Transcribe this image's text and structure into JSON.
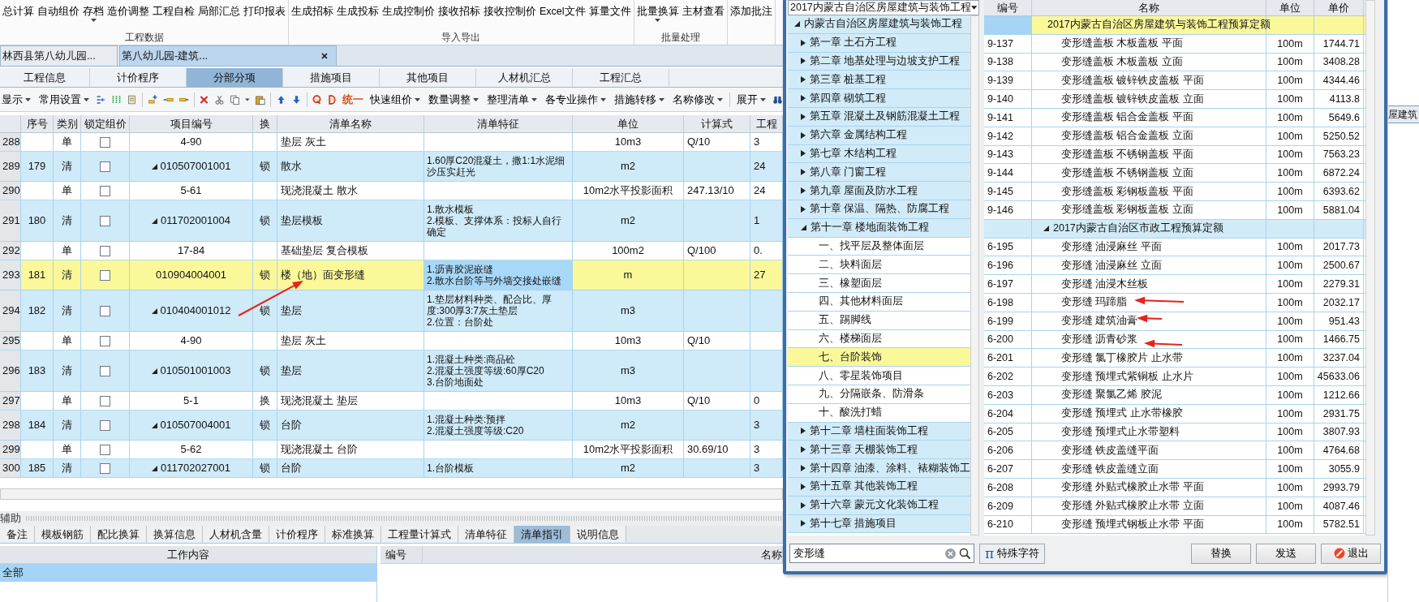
{
  "ribbon": {
    "groups": [
      {
        "label": "工程数据",
        "buttons": [
          {
            "label": "总计算",
            "dropdown": false
          },
          {
            "label": "自动组价",
            "dropdown": false
          },
          {
            "label": "存档",
            "dropdown": true
          },
          {
            "label": "造价调整",
            "dropdown": false
          },
          {
            "label": "工程自检",
            "dropdown": false
          },
          {
            "label": "局部汇总",
            "dropdown": false
          },
          {
            "label": "打印报表",
            "dropdown": false
          }
        ]
      },
      {
        "label": "导入导出",
        "buttons": [
          {
            "label": "生成招标",
            "dropdown": false
          },
          {
            "label": "生成投标",
            "dropdown": false
          },
          {
            "label": "生成控制价",
            "dropdown": false
          },
          {
            "label": "接收招标",
            "dropdown": false
          },
          {
            "label": "接收控制价",
            "dropdown": false
          },
          {
            "label": "Excel文件",
            "dropdown": false
          },
          {
            "label": "算量文件",
            "dropdown": false
          }
        ]
      },
      {
        "label": "批量处理",
        "buttons": [
          {
            "label": "批量换算",
            "dropdown": true
          },
          {
            "label": "主材查看",
            "dropdown": false
          }
        ]
      },
      {
        "buttons": [
          {
            "label": "添加批注",
            "dropdown": false
          }
        ]
      }
    ]
  },
  "document_tabs": [
    {
      "label": "林西县第八幼儿园...",
      "selected": false
    },
    {
      "label": "第八幼儿园-建筑...",
      "selected": true,
      "closable": true
    }
  ],
  "view_tabs": [
    {
      "label": "工程信息",
      "selected": false
    },
    {
      "label": "计价程序",
      "selected": false
    },
    {
      "label": "分部分项",
      "selected": true
    },
    {
      "label": "措施项目",
      "selected": false
    },
    {
      "label": "其他项目",
      "selected": false
    },
    {
      "label": "人材机汇总",
      "selected": false
    },
    {
      "label": "工程汇总",
      "selected": false
    }
  ],
  "toolbar": {
    "menus": [
      {
        "label": "显示",
        "dropdown": true
      },
      {
        "label": "常用设置",
        "dropdown": true
      }
    ],
    "unify_label": "统一",
    "actions": [
      {
        "label": "快速组价",
        "dropdown": true
      },
      {
        "label": "数量调整",
        "dropdown": true
      },
      {
        "label": "整理清单",
        "dropdown": true
      },
      {
        "label": "各专业操作",
        "dropdown": true
      },
      {
        "label": "措施转移",
        "dropdown": true
      },
      {
        "label": "名称修改",
        "dropdown": true
      },
      {
        "label": "展开",
        "dropdown": true
      }
    ]
  },
  "table": {
    "columns": [
      "",
      "序号",
      "类别",
      "锁定组价",
      "项目编号",
      "换",
      "清单名称",
      "清单特征",
      "单位",
      "计算式",
      "工程"
    ],
    "rows": [
      {
        "row": "288",
        "seq": "",
        "kind": "dan",
        "type": "单",
        "locked": false,
        "code": "4-90",
        "swap": "",
        "name": "垫层 灰土",
        "features": [],
        "unit": "10m3",
        "formula": "Q/10",
        "qty": "3",
        "selected": false
      },
      {
        "row": "289",
        "seq": "179",
        "kind": "qing",
        "type": "清",
        "locked": false,
        "expanded": true,
        "code": "010507001001",
        "swap": "锁",
        "name": "散水",
        "features": [
          "1.60厚C20混凝土，撒1:1水泥细沙压实赶光"
        ],
        "unit": "m2",
        "formula": "",
        "qty": "24",
        "selected": false
      },
      {
        "row": "290",
        "seq": "",
        "kind": "dan",
        "type": "单",
        "locked": false,
        "code": "5-61",
        "swap": "",
        "name": "现浇混凝土 散水",
        "features": [],
        "unit": "10m2水平投影面积",
        "formula": "247.13/10",
        "qty": "24",
        "selected": false
      },
      {
        "row": "291",
        "seq": "180",
        "kind": "qing",
        "type": "清",
        "locked": false,
        "expanded": true,
        "code": "011702001004",
        "swap": "锁",
        "name": "垫层模板",
        "features": [
          "1.散水模板",
          "2.模板、支撑体系：投标人自行确定"
        ],
        "unit": "m2",
        "formula": "",
        "qty": "1",
        "selected": false
      },
      {
        "row": "292",
        "seq": "",
        "kind": "dan",
        "type": "单",
        "locked": false,
        "code": "17-84",
        "swap": "",
        "name": "基础垫层 复合模板",
        "features": [],
        "unit": "100m2",
        "formula": "Q/100",
        "qty": "0.",
        "selected": false
      },
      {
        "row": "293",
        "seq": "181",
        "kind": "qing",
        "type": "清",
        "locked": false,
        "code": "010904004001",
        "swap": "锁",
        "name": "楼（地）面变形缝",
        "features": [
          "1.沥青胶泥嵌缝",
          "2.散水台阶等与外墙交接处嵌缝"
        ],
        "unit": "m",
        "formula": "",
        "qty": "27",
        "selected": true
      },
      {
        "row": "294",
        "seq": "182",
        "kind": "qing",
        "type": "清",
        "locked": false,
        "expanded": true,
        "code": "010404001012",
        "swap": "锁",
        "name": "垫层",
        "features": [
          "1.垫层材料种类、配合比、厚度:300厚3:7灰土垫层",
          "2.位置：台阶处"
        ],
        "unit": "m3",
        "formula": "",
        "qty": "",
        "selected": false
      },
      {
        "row": "295",
        "seq": "",
        "kind": "dan",
        "type": "单",
        "locked": false,
        "code": "4-90",
        "swap": "",
        "name": "垫层 灰土",
        "features": [],
        "unit": "10m3",
        "formula": "Q/10",
        "qty": "",
        "selected": false
      },
      {
        "row": "296",
        "seq": "183",
        "kind": "qing",
        "type": "清",
        "locked": false,
        "expanded": true,
        "code": "010501001003",
        "swap": "锁",
        "name": "垫层",
        "features": [
          "1.混凝土种类:商品砼",
          "2.混凝土强度等级:60厚C20",
          "3.台阶地面处"
        ],
        "unit": "m3",
        "formula": "",
        "qty": "",
        "selected": false
      },
      {
        "row": "297",
        "seq": "",
        "kind": "dan",
        "type": "单",
        "locked": false,
        "code": "5-1",
        "swap": "换",
        "name": "现浇混凝土 垫层",
        "features": [],
        "unit": "10m3",
        "formula": "Q/10",
        "qty": "0",
        "selected": false
      },
      {
        "row": "298",
        "seq": "184",
        "kind": "qing",
        "type": "清",
        "locked": false,
        "expanded": true,
        "code": "010507004001",
        "swap": "锁",
        "name": "台阶",
        "features": [
          "1.混凝土种类:预拌",
          "2.混凝土强度等级:C20"
        ],
        "unit": "m2",
        "formula": "",
        "qty": "3",
        "selected": false
      },
      {
        "row": "299",
        "seq": "",
        "kind": "dan",
        "type": "单",
        "locked": false,
        "code": "5-62",
        "swap": "",
        "name": "现浇混凝土 台阶",
        "features": [],
        "unit": "10m2水平投影面积",
        "formula": "30.69/10",
        "qty": "3",
        "selected": false
      },
      {
        "row": "300",
        "seq": "185",
        "kind": "qing",
        "type": "清",
        "locked": false,
        "expanded": true,
        "code": "011702027001",
        "swap": "锁",
        "name": "台阶",
        "features": [
          "1.台阶模板"
        ],
        "unit": "m2",
        "formula": "",
        "qty": "3",
        "selected": false
      }
    ]
  },
  "aux_panel": {
    "title": "辅助",
    "tabs": [
      {
        "label": "备注",
        "selected": false
      },
      {
        "label": "模板钢筋",
        "selected": false
      },
      {
        "label": "配比换算",
        "selected": false
      },
      {
        "label": "换算信息",
        "selected": false
      },
      {
        "label": "人材机含量",
        "selected": false
      },
      {
        "label": "计价程序",
        "selected": false
      },
      {
        "label": "标准换算",
        "selected": false
      },
      {
        "label": "工程量计算式",
        "selected": false
      },
      {
        "label": "清单特征",
        "selected": false
      },
      {
        "label": "清单指引",
        "selected": true
      },
      {
        "label": "说明信息",
        "selected": false
      }
    ],
    "work_content": {
      "header": "工作内容",
      "rows": [
        {
          "label": "全部",
          "selected": true
        }
      ]
    },
    "guide_columns": [
      "编号",
      "名称"
    ]
  },
  "dialog": {
    "library": "2017内蒙古自治区房屋建筑与装饰工程",
    "tree": [
      {
        "label": "内蒙古自治区房屋建筑与装饰工程",
        "expanded": true,
        "selected": false,
        "children": [
          {
            "label": "第一章 土石方工程",
            "expanded": false,
            "selected": false
          },
          {
            "label": "第二章 地基处理与边坡支护工程",
            "expanded": false,
            "selected": false
          },
          {
            "label": "第三章 桩基工程",
            "expanded": false,
            "selected": false
          },
          {
            "label": "第四章 砌筑工程",
            "expanded": false,
            "selected": false
          },
          {
            "label": "第五章 混凝土及钢筋混凝土工程",
            "expanded": false,
            "selected": false
          },
          {
            "label": "第六章 金属结构工程",
            "expanded": false,
            "selected": false
          },
          {
            "label": "第七章 木结构工程",
            "expanded": false,
            "selected": false
          },
          {
            "label": "第八章 门窗工程",
            "expanded": false,
            "selected": false
          },
          {
            "label": "第九章 屋面及防水工程",
            "expanded": false,
            "selected": false
          },
          {
            "label": "第十章 保温、隔热、防腐工程",
            "expanded": false,
            "selected": false
          },
          {
            "label": "第十一章 楼地面装饰工程",
            "expanded": true,
            "selected": false,
            "children": [
              {
                "label": "一、找平层及整体面层",
                "selected": false
              },
              {
                "label": "二、块料面层",
                "selected": false
              },
              {
                "label": "三、橡塑面层",
                "selected": false
              },
              {
                "label": "四、其他材料面层",
                "selected": false
              },
              {
                "label": "五、踢脚线",
                "selected": false
              },
              {
                "label": "六、楼梯面层",
                "selected": false
              },
              {
                "label": "七、台阶装饰",
                "selected": true
              },
              {
                "label": "八、零星装饰项目",
                "selected": false
              },
              {
                "label": "九、分隔嵌条、防滑条",
                "selected": false
              },
              {
                "label": "十、酸洗打蜡",
                "selected": false
              }
            ]
          },
          {
            "label": "第十二章 墙柱面装饰工程",
            "expanded": false,
            "selected": false
          },
          {
            "label": "第十三章 天棚装饰工程",
            "expanded": false,
            "selected": false
          },
          {
            "label": "第十四章 油漆、涂料、裱糊装饰工",
            "expanded": false,
            "selected": false
          },
          {
            "label": "第十五章 其他装饰工程",
            "expanded": false,
            "selected": false
          },
          {
            "label": "第十六章 蒙元文化装饰工程",
            "expanded": false,
            "selected": false
          },
          {
            "label": "第十七章 措施项目",
            "expanded": false,
            "selected": false
          }
        ]
      }
    ],
    "grid": {
      "columns": [
        "编号",
        "名称",
        "单位",
        "单价"
      ],
      "rows": [
        {
          "kind": "group",
          "name": "2017内蒙古自治区房屋建筑与装饰工程预算定额",
          "expanded": true,
          "selected": true
        },
        {
          "kind": "item",
          "code": "9-137",
          "name": "变形缝盖板 木板盖板 平面",
          "unit": "100m",
          "price": "1744.71",
          "selected": false
        },
        {
          "kind": "item",
          "code": "9-138",
          "name": "变形缝盖板 木板盖板 立面",
          "unit": "100m",
          "price": "3408.28",
          "selected": false
        },
        {
          "kind": "item",
          "code": "9-139",
          "name": "变形缝盖板 镀锌铁皮盖板 平面",
          "unit": "100m",
          "price": "4344.46",
          "selected": false
        },
        {
          "kind": "item",
          "code": "9-140",
          "name": "变形缝盖板 镀锌铁皮盖板 立面",
          "unit": "100m",
          "price": "4113.8",
          "selected": false
        },
        {
          "kind": "item",
          "code": "9-141",
          "name": "变形缝盖板 铝合金盖板 平面",
          "unit": "100m",
          "price": "5649.6",
          "selected": false
        },
        {
          "kind": "item",
          "code": "9-142",
          "name": "变形缝盖板 铝合金盖板 立面",
          "unit": "100m",
          "price": "5250.52",
          "selected": false
        },
        {
          "kind": "item",
          "code": "9-143",
          "name": "变形缝盖板 不锈钢盖板 平面",
          "unit": "100m",
          "price": "7563.23",
          "selected": false
        },
        {
          "kind": "item",
          "code": "9-144",
          "name": "变形缝盖板 不锈钢盖板 立面",
          "unit": "100m",
          "price": "6872.24",
          "selected": false
        },
        {
          "kind": "item",
          "code": "9-145",
          "name": "变形缝盖板 彩钢板盖板 平面",
          "unit": "100m",
          "price": "6393.62",
          "selected": false
        },
        {
          "kind": "item",
          "code": "9-146",
          "name": "变形缝盖板 彩钢板盖板 立面",
          "unit": "100m",
          "price": "5881.04",
          "selected": false
        },
        {
          "kind": "group",
          "name": "2017内蒙古自治区市政工程预算定额",
          "expanded": true,
          "selected": false
        },
        {
          "kind": "item",
          "code": "6-195",
          "name": "变形缝 油浸麻丝 平面",
          "unit": "100m",
          "price": "2017.73",
          "selected": false
        },
        {
          "kind": "item",
          "code": "6-196",
          "name": "变形缝 油浸麻丝 立面",
          "unit": "100m",
          "price": "2500.67",
          "selected": false
        },
        {
          "kind": "item",
          "code": "6-197",
          "name": "变形缝 油浸木丝板",
          "unit": "100m",
          "price": "2279.31",
          "selected": false
        },
        {
          "kind": "item",
          "code": "6-198",
          "name": "变形缝 玛蹄脂",
          "unit": "100m",
          "price": "2032.17",
          "selected": false
        },
        {
          "kind": "item",
          "code": "6-199",
          "name": "变形缝 建筑油膏",
          "unit": "100m",
          "price": "951.43",
          "selected": false
        },
        {
          "kind": "item",
          "code": "6-200",
          "name": "变形缝 沥青砂浆",
          "unit": "100m",
          "price": "1466.75",
          "selected": false
        },
        {
          "kind": "item",
          "code": "6-201",
          "name": "变形缝 氯丁橡胶片 止水带",
          "unit": "100m",
          "price": "3237.04",
          "selected": false
        },
        {
          "kind": "item",
          "code": "6-202",
          "name": "变形缝 预埋式紫铜板 止水片",
          "unit": "100m",
          "price": "45633.06",
          "selected": false
        },
        {
          "kind": "item",
          "code": "6-203",
          "name": "变形缝 聚氯乙烯 胶泥",
          "unit": "100m",
          "price": "1212.66",
          "selected": false
        },
        {
          "kind": "item",
          "code": "6-204",
          "name": "变形缝 预埋式 止水带橡胶",
          "unit": "100m",
          "price": "2931.75",
          "selected": false
        },
        {
          "kind": "item",
          "code": "6-205",
          "name": "变形缝 预埋式止水带塑料",
          "unit": "100m",
          "price": "3807.93",
          "selected": false
        },
        {
          "kind": "item",
          "code": "6-206",
          "name": "变形缝 铁皮盖缝平面",
          "unit": "100m",
          "price": "4764.68",
          "selected": false
        },
        {
          "kind": "item",
          "code": "6-207",
          "name": "变形缝 铁皮盖缝立面",
          "unit": "100m",
          "price": "3055.9",
          "selected": false
        },
        {
          "kind": "item",
          "code": "6-208",
          "name": "变形缝 外贴式橡胶止水带 平面",
          "unit": "100m",
          "price": "2993.79",
          "selected": false
        },
        {
          "kind": "item",
          "code": "6-209",
          "name": "变形缝 外贴式橡胶止水带 立面",
          "unit": "100m",
          "price": "4087.46",
          "selected": false
        },
        {
          "kind": "item",
          "code": "6-210",
          "name": "变形缝 预埋式钢板止水带 平面",
          "unit": "100m",
          "price": "5782.51",
          "selected": false
        }
      ]
    },
    "search": {
      "value": "变形缝"
    },
    "special_button": {
      "symbol": "π",
      "label": "特殊字符"
    },
    "buttons": [
      {
        "label": "替换",
        "kind": "plain"
      },
      {
        "label": "发送",
        "kind": "plain"
      },
      {
        "label": "退出",
        "kind": "exit"
      }
    ]
  },
  "background_window": {
    "text": "屋建筑"
  }
}
